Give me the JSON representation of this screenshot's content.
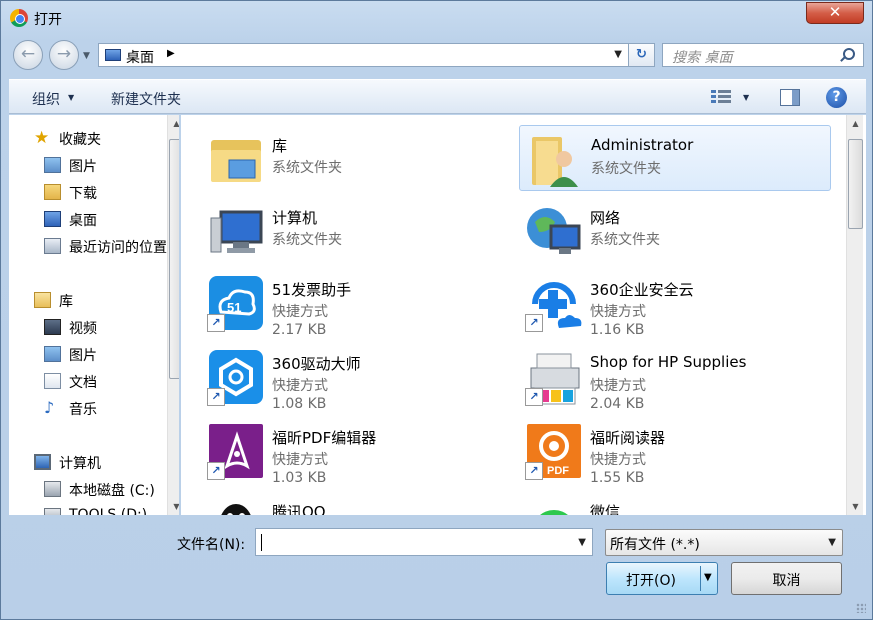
{
  "window": {
    "title": "打开",
    "close_glyph": "✕"
  },
  "nav": {
    "back_glyph": "←",
    "forward_glyph": "→",
    "address": "桌面",
    "search_placeholder": "搜索 桌面"
  },
  "toolbar": {
    "organize": "组织",
    "new_folder": "新建文件夹",
    "help_glyph": "?"
  },
  "sidebar": {
    "items": [
      {
        "label": "收藏夹",
        "icon": "star-icon"
      },
      {
        "label": "图片",
        "icon": "pictures-icon"
      },
      {
        "label": "下载",
        "icon": "download-folder-icon"
      },
      {
        "label": "桌面",
        "icon": "desktop-icon"
      },
      {
        "label": "最近访问的位置",
        "icon": "recent-places-icon"
      },
      {
        "label": "库",
        "icon": "library-icon"
      },
      {
        "label": "视频",
        "icon": "videos-icon"
      },
      {
        "label": "图片",
        "icon": "pictures-icon"
      },
      {
        "label": "文档",
        "icon": "documents-icon"
      },
      {
        "label": "音乐",
        "icon": "music-icon"
      },
      {
        "label": "计算机",
        "icon": "computer-icon"
      },
      {
        "label": "本地磁盘 (C:)",
        "icon": "drive-icon"
      },
      {
        "label": "TOOLS (D:)",
        "icon": "drive-icon"
      }
    ]
  },
  "files": [
    {
      "name": "库",
      "type": "系统文件夹",
      "size": "",
      "icon": "library-folder-icon"
    },
    {
      "name": "Administrator",
      "type": "系统文件夹",
      "size": "",
      "icon": "user-folder-icon"
    },
    {
      "name": "计算机",
      "type": "系统文件夹",
      "size": "",
      "icon": "computer-icon"
    },
    {
      "name": "网络",
      "type": "系统文件夹",
      "size": "",
      "icon": "network-icon"
    },
    {
      "name": "51发票助手",
      "type": "快捷方式",
      "size": "2.17 KB",
      "icon": "invoice-assistant-icon"
    },
    {
      "name": "360企业安全云",
      "type": "快捷方式",
      "size": "1.16 KB",
      "icon": "security-cloud-icon"
    },
    {
      "name": "360驱动大师",
      "type": "快捷方式",
      "size": "1.08 KB",
      "icon": "driver-master-icon"
    },
    {
      "name": "Shop for HP Supplies",
      "type": "快捷方式",
      "size": "2.04 KB",
      "icon": "printer-icon"
    },
    {
      "name": "福昕PDF编辑器",
      "type": "快捷方式",
      "size": "1.03 KB",
      "icon": "pdf-editor-icon"
    },
    {
      "name": "福昕阅读器",
      "type": "快捷方式",
      "size": "1.55 KB",
      "icon": "pdf-reader-icon"
    },
    {
      "name": "腾讯QQ",
      "type": "",
      "size": "",
      "icon": "qq-penguin-icon"
    },
    {
      "name": "微信",
      "type": "",
      "size": "",
      "icon": "wechat-icon"
    }
  ],
  "footer": {
    "filename_label": "文件名(N):",
    "filename_value": "",
    "filetype": "所有文件 (*.*)",
    "open": "打开(O)",
    "cancel": "取消"
  }
}
